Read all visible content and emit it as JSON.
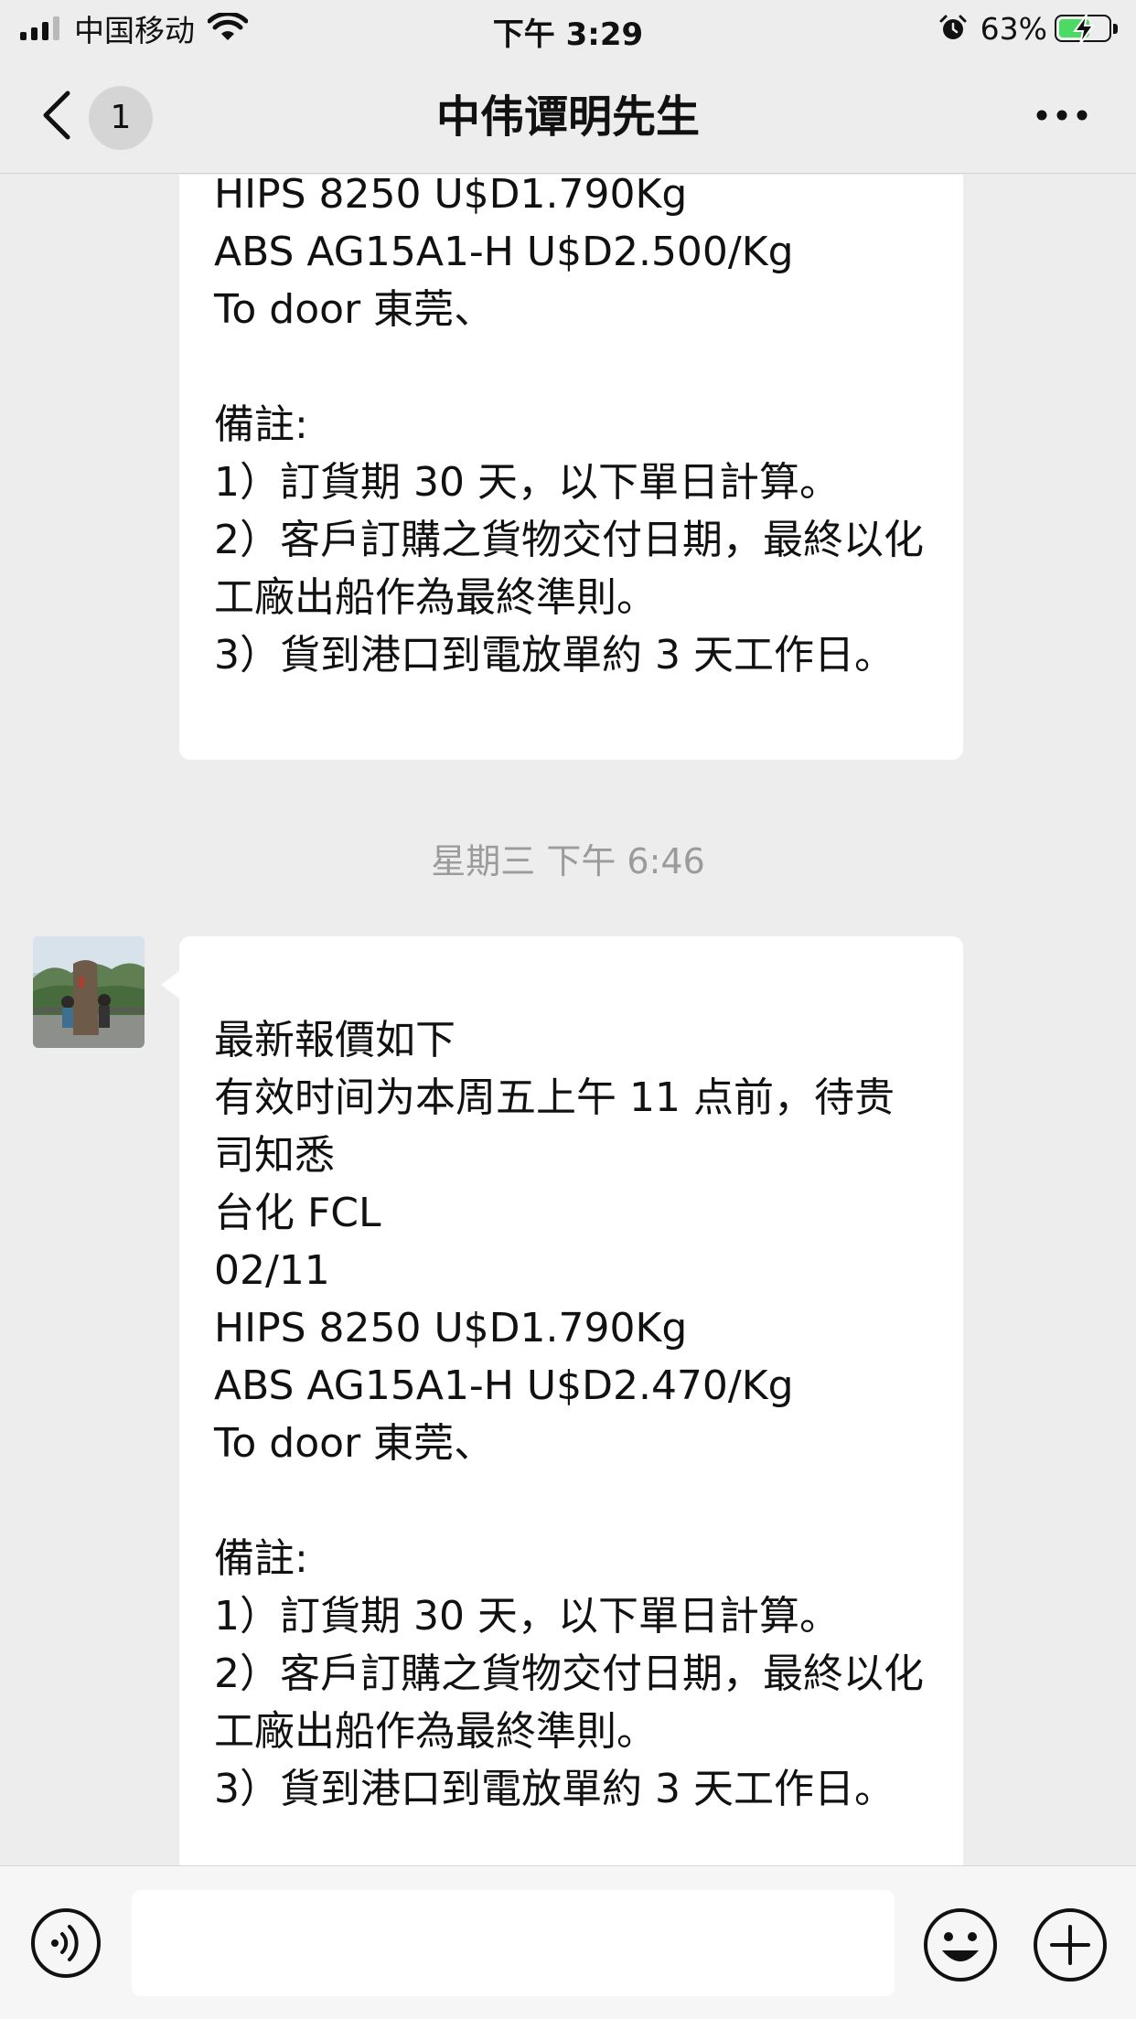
{
  "status_bar": {
    "carrier": "中国移动",
    "time": "下午 3:29",
    "battery": "63%",
    "battery_level": 0.63
  },
  "nav": {
    "back_label": "back",
    "unread_count": "1",
    "title": "中伟谭明先生"
  },
  "messages": {
    "msg1_text": "HIPS 8250 U$D1.790Kg\nABS AG15A1-H  U$D2.500/Kg\nTo door 東莞、\n\n備註:\n1）訂貨期 30 天，以下單日計算。\n2）客戶訂購之貨物交付日期，最終以化工廠出船作為最終準則。\n3）貨到港口到電放單約 3 天工作日。",
    "timestamp": "星期三 下午 6:46",
    "msg2_text": "最新報價如下\n有效时间为本周五上午 11 点前，待贵司知悉\n台化 FCL\n02/11\nHIPS 8250 U$D1.790Kg\nABS AG15A1-H  U$D2.470/Kg\nTo door 東莞、\n\n備註:\n1）訂貨期 30 天，以下單日計算。\n2）客戶訂購之貨物交付日期，最終以化工廠出船作為最終準則。\n3）貨到港口到電放單約 3 天工作日。"
  },
  "input_bar": {
    "placeholder": ""
  },
  "icons": {
    "back": "chevron-left-icon",
    "more": "more-dots-icon",
    "voice": "voice-icon",
    "emoji": "emoji-icon",
    "plus": "plus-icon",
    "wifi": "wifi-icon",
    "alarm": "alarm-icon"
  },
  "colors": {
    "background": "#ededed",
    "bubble": "#ffffff",
    "battery_fill": "#4cd964"
  }
}
